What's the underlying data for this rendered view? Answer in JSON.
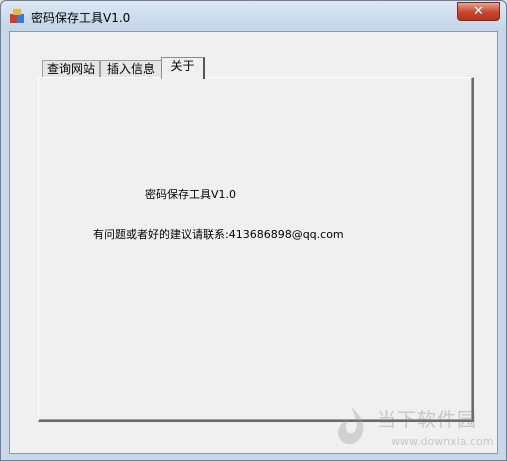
{
  "window": {
    "title": "密码保存工具V1.0",
    "close_glyph": "✕"
  },
  "tabs": [
    {
      "label": "查询网站",
      "active": false
    },
    {
      "label": "插入信息",
      "active": false
    },
    {
      "label": "关于",
      "active": true
    }
  ],
  "about": {
    "title": "密码保存工具V1.0",
    "contact": "有问题或者好的建议请联系:413686898@qq.com"
  },
  "watermark": {
    "logo_text": "当下软件园",
    "url": "www.downxia.com"
  },
  "colors": {
    "close_button": "#c7432b",
    "client_bg": "#f0f0f0",
    "titlebar": "#c3d5e8"
  },
  "icons": {
    "app": "app-icon",
    "close": "close-icon",
    "watermark_logo": "downxia-logo-icon"
  }
}
